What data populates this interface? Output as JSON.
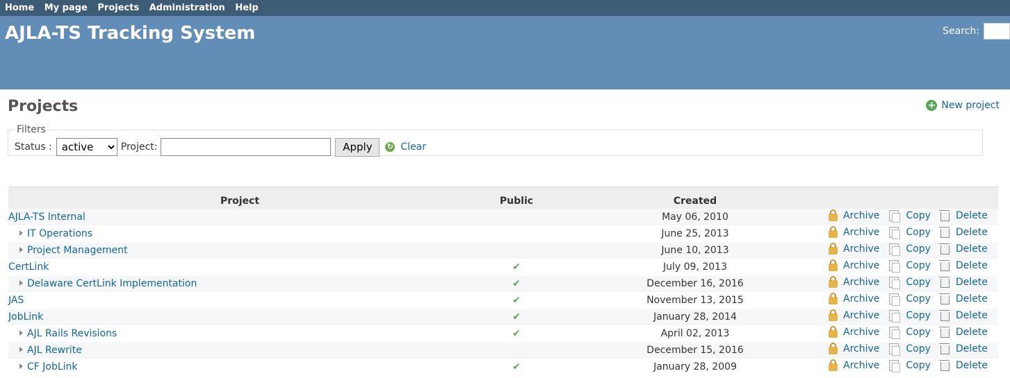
{
  "top_menu": [
    "Home",
    "My page",
    "Projects",
    "Administration",
    "Help"
  ],
  "header": {
    "title": "AJLA-TS Tracking System",
    "search_label": "Search:"
  },
  "page": {
    "title": "Projects",
    "new_project": "New project"
  },
  "filters": {
    "legend": "Filters",
    "status_label": "Status :",
    "status_value": "active",
    "project_label": "Project:",
    "project_value": "",
    "apply": "Apply",
    "clear": "Clear"
  },
  "table": {
    "headers": {
      "project": "Project",
      "public": "Public",
      "created": "Created"
    },
    "actions": {
      "archive": "Archive",
      "copy": "Copy",
      "delete": "Delete"
    },
    "rows": [
      {
        "name": "AJLA-TS Internal",
        "child": false,
        "public": false,
        "created": "May 06, 2010"
      },
      {
        "name": "IT Operations",
        "child": true,
        "public": false,
        "created": "June 25, 2013"
      },
      {
        "name": "Project Management",
        "child": true,
        "public": false,
        "created": "June 10, 2013"
      },
      {
        "name": "CertLink",
        "child": false,
        "public": true,
        "created": "July 09, 2013"
      },
      {
        "name": "Delaware CertLink Implementation",
        "child": true,
        "public": true,
        "created": "December 16, 2016"
      },
      {
        "name": "JAS",
        "child": false,
        "public": true,
        "created": "November 13, 2015"
      },
      {
        "name": "JobLink",
        "child": false,
        "public": true,
        "created": "January 28, 2014"
      },
      {
        "name": "AJL Rails Revisions",
        "child": true,
        "public": true,
        "created": "April 02, 2013"
      },
      {
        "name": "AJL Rewrite",
        "child": true,
        "public": false,
        "created": "December 15, 2016"
      },
      {
        "name": "CF JobLink",
        "child": true,
        "public": true,
        "created": "January 28, 2009"
      }
    ]
  }
}
